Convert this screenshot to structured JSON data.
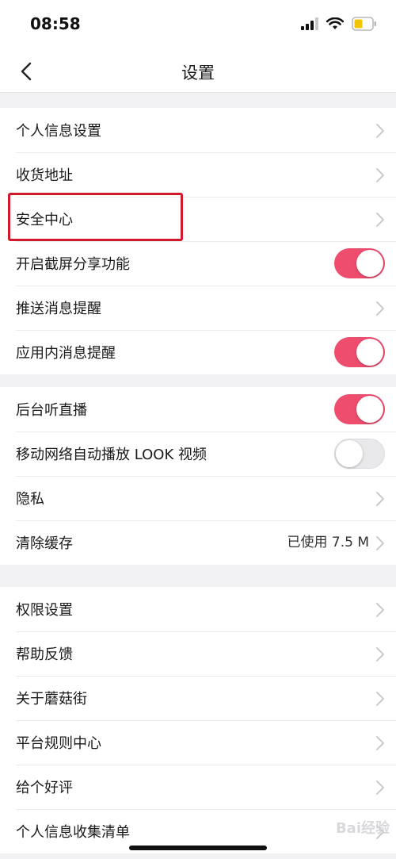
{
  "status_bar": {
    "time": "08:58"
  },
  "nav": {
    "title": "设置"
  },
  "groups": [
    {
      "items": [
        {
          "label": "个人信息设置",
          "type": "link"
        },
        {
          "label": "收货地址",
          "type": "link"
        },
        {
          "label": "安全中心",
          "type": "link"
        },
        {
          "label": "开启截屏分享功能",
          "type": "toggle",
          "on": true
        },
        {
          "label": "推送消息提醒",
          "type": "link"
        },
        {
          "label": "应用内消息提醒",
          "type": "toggle",
          "on": true
        }
      ]
    },
    {
      "items": [
        {
          "label": "后台听直播",
          "type": "toggle",
          "on": true
        },
        {
          "label": "移动网络自动播放 LOOK 视频",
          "type": "toggle",
          "on": false
        },
        {
          "label": "隐私",
          "type": "link"
        },
        {
          "label": "清除缓存",
          "type": "link",
          "value": "已使用 7.5 M"
        }
      ]
    },
    {
      "items": [
        {
          "label": "权限设置",
          "type": "link"
        },
        {
          "label": "帮助反馈",
          "type": "link"
        },
        {
          "label": "关于蘑菇街",
          "type": "link"
        },
        {
          "label": "平台规则中心",
          "type": "link"
        },
        {
          "label": "给个好评",
          "type": "link"
        },
        {
          "label": "个人信息收集清单",
          "type": "link"
        }
      ]
    }
  ],
  "watermark": "Bai经验",
  "colors": {
    "toggle_on": "#ee4d6d",
    "highlight": "#d0192b"
  }
}
